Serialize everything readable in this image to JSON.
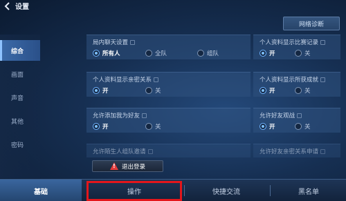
{
  "header": {
    "title": "设置",
    "net_button": "网络诊断"
  },
  "sidebar": {
    "items": [
      {
        "label": "综合",
        "active": true
      },
      {
        "label": "画面",
        "active": false
      },
      {
        "label": "声音",
        "active": false
      },
      {
        "label": "其他",
        "active": false
      },
      {
        "label": "密码",
        "active": false
      }
    ]
  },
  "settings": {
    "chat": {
      "label": "局内聊天设置",
      "options": [
        "所有人",
        "全队",
        "组队"
      ],
      "selected": "所有人"
    },
    "match_record": {
      "label": "个人资料显示比赛记录",
      "options": [
        "开",
        "关"
      ],
      "selected": "开"
    },
    "intimacy": {
      "label": "个人资料显示亲密关系",
      "options": [
        "开",
        "关"
      ],
      "selected": "开"
    },
    "achievements": {
      "label": "个人资料显示所获成就",
      "options": [
        "开",
        "关"
      ],
      "selected": "开"
    },
    "add_friend": {
      "label": "允许添加我为好友",
      "options": [
        "开",
        "关"
      ],
      "selected": "开"
    },
    "spectate": {
      "label": "允许好友观战",
      "options": [
        "开",
        "关"
      ],
      "selected": "开"
    },
    "stranger_invite": {
      "label": "允许陌生人组队邀请"
    },
    "intimacy_request": {
      "label": "允许好友亲密关系申请"
    }
  },
  "logout": {
    "label": "退出登录"
  },
  "tabs": [
    {
      "label": "基础",
      "active": true
    },
    {
      "label": "操作",
      "active": false
    },
    {
      "label": "快捷交流",
      "active": false
    },
    {
      "label": "黑名单",
      "active": false
    }
  ],
  "colors": {
    "accent": "#6fb3ff",
    "highlight": "#e4161b",
    "warning": "#e33b3b"
  }
}
